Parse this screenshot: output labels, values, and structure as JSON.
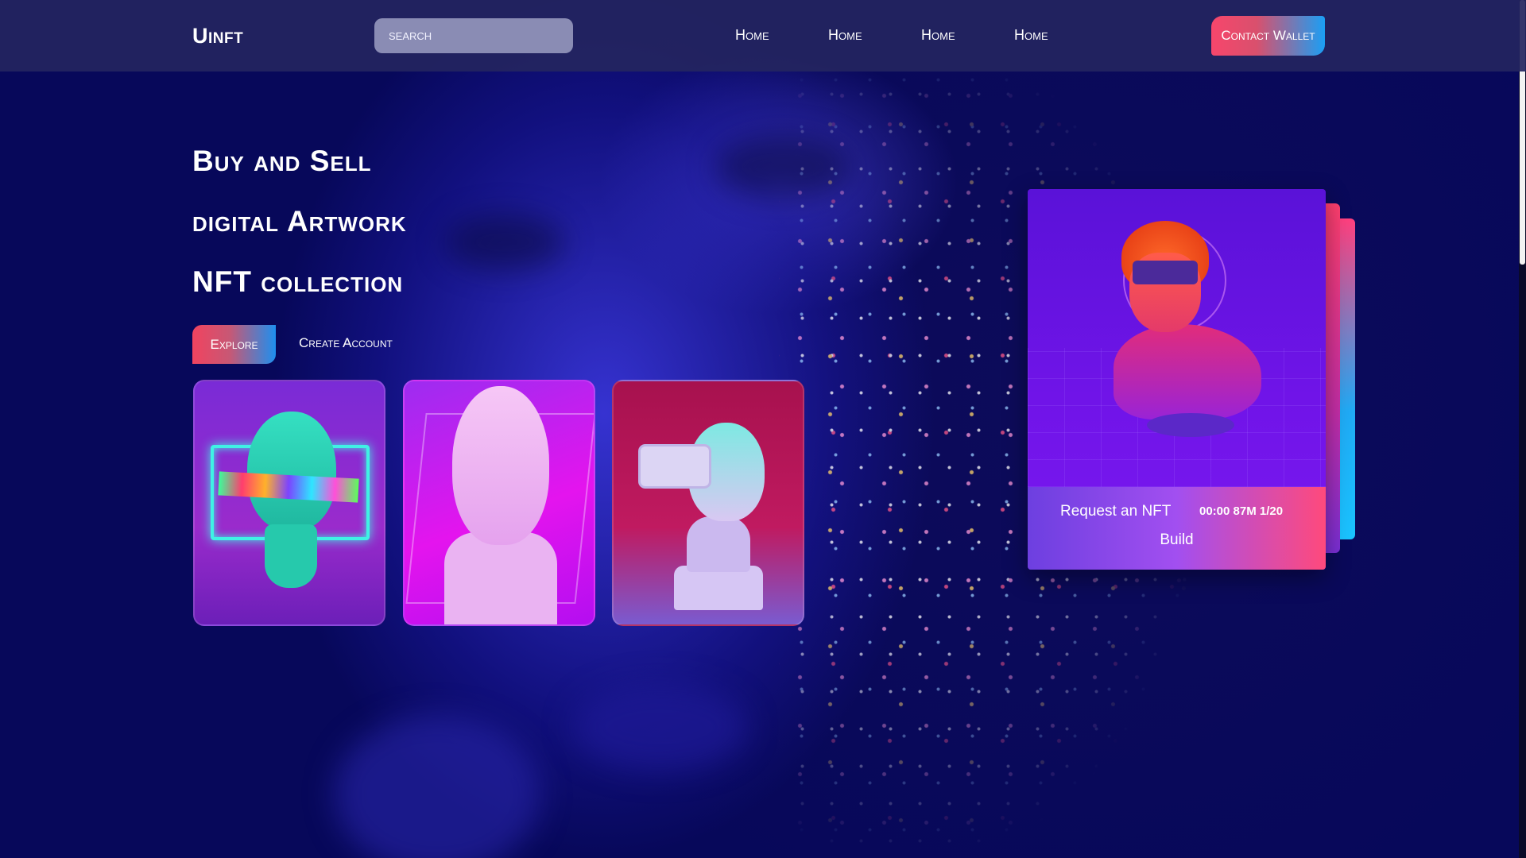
{
  "header": {
    "logo": "Uinft",
    "search_placeholder": "SEARCH",
    "nav": [
      "Home",
      "Home",
      "Home",
      "Home"
    ],
    "contact_label": "Contact Wallet"
  },
  "hero": {
    "lines": [
      "Buy and Sell",
      "digital Artwork",
      "NFT collection"
    ],
    "explore_label": "Explore",
    "create_label": "Create Account"
  },
  "feature": {
    "request_label": "Request an NFT",
    "timer": "00:00 87M 1/20",
    "build_label": "Build"
  },
  "colors": {
    "background": "#07085a",
    "header": "#242560",
    "accent_red": "#f7466c",
    "accent_blue": "#1a9ff5"
  }
}
